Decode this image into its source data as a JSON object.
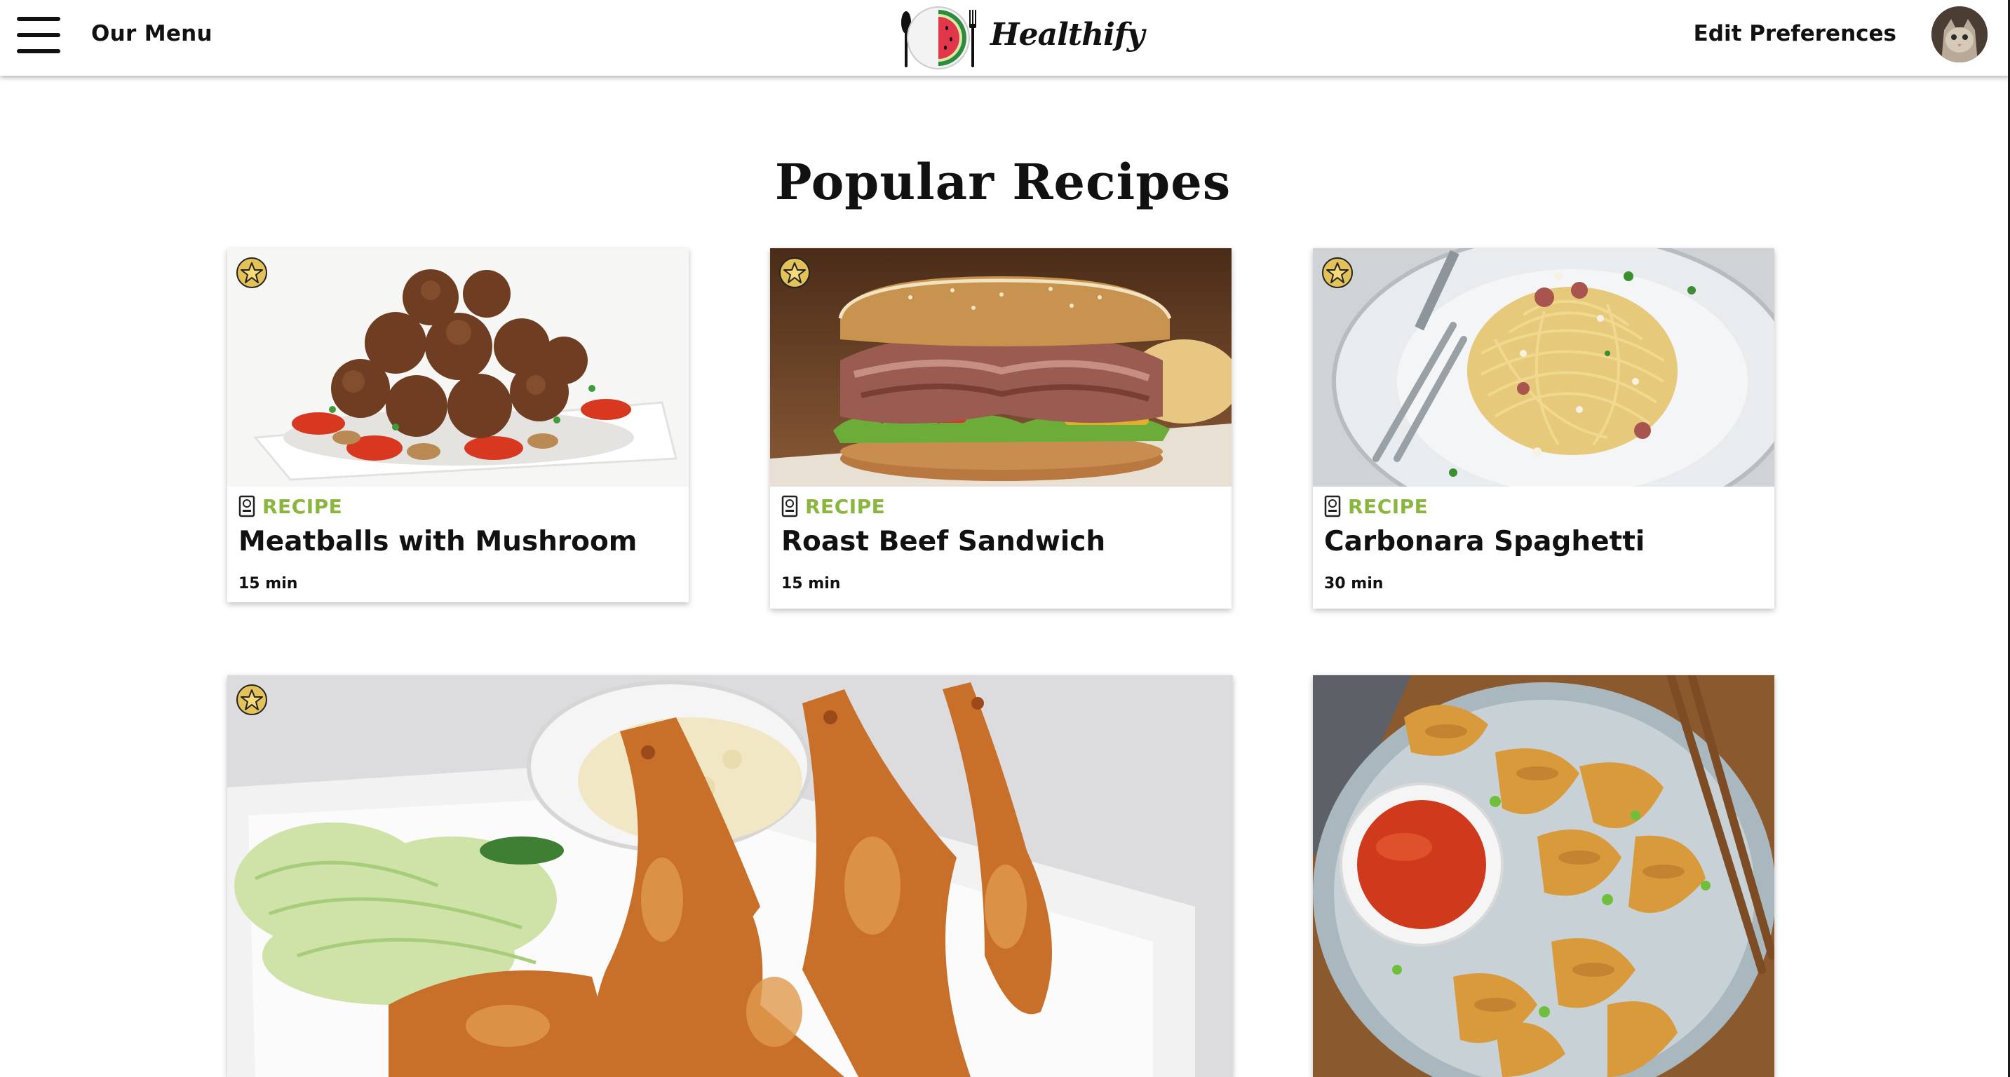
{
  "header": {
    "menu_label": "Our Menu",
    "brand_name": "Healthify",
    "edit_preferences_label": "Edit Preferences",
    "icons": {
      "menu": "hamburger-menu-icon",
      "logo": "plate-watermelon-cutlery-logo",
      "avatar": "user-avatar-cat"
    }
  },
  "main": {
    "title": "Popular Recipes",
    "recipes": [
      {
        "type_label": "RECIPE",
        "title": "Meatballs with Mushroom",
        "time": "15 min",
        "image": "meatballs-photo"
      },
      {
        "type_label": "RECIPE",
        "title": "Roast Beef Sandwich",
        "time": "15 min",
        "image": "sandwich-photo"
      },
      {
        "type_label": "RECIPE",
        "title": "Carbonara Spaghetti",
        "time": "30 min",
        "image": "spaghetti-photo"
      }
    ],
    "featured": [
      {
        "image": "fried-shrimp-photo",
        "has_star": true
      },
      {
        "image": "dumplings-photo",
        "has_star": false
      }
    ]
  },
  "colors": {
    "recipe_label": "#8ab640",
    "star_fill": "#e3c25a",
    "text": "#111111",
    "background": "#ffffff"
  }
}
